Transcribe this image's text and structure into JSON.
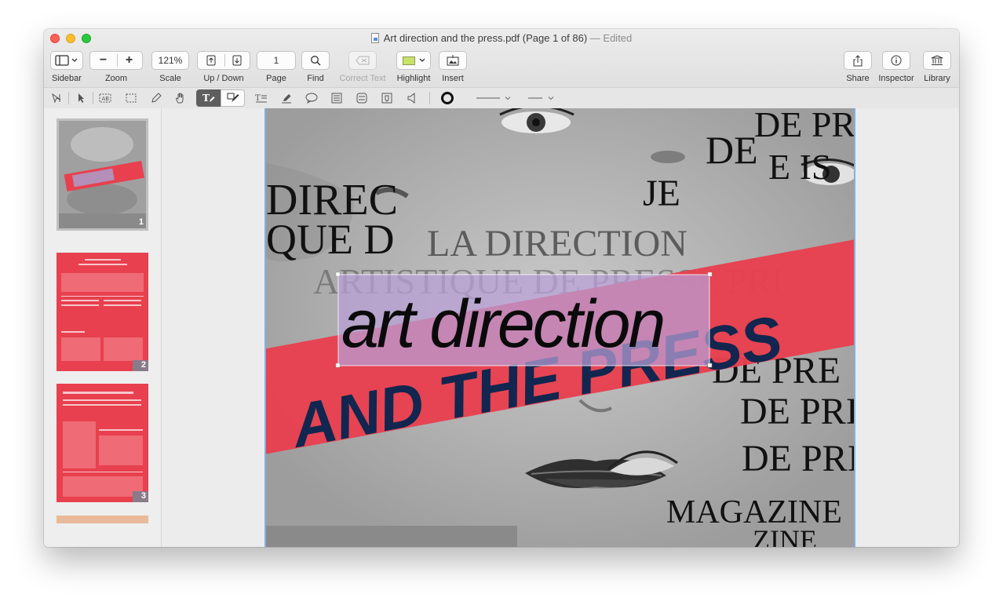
{
  "window": {
    "filename": "Art direction and the press.pdf",
    "page_info": "(Page 1 of 86)",
    "status": "— Edited"
  },
  "toolbar": {
    "sidebar_label": "Sidebar",
    "zoom_label": "Zoom",
    "zoom_out": "−",
    "zoom_in": "+",
    "scale_value": "121%",
    "scale_label": "Scale",
    "updown_label": "Up / Down",
    "page_value": "1",
    "page_label": "Page",
    "find_label": "Find",
    "correct_text_label": "Correct Text",
    "highlight_label": "Highlight",
    "highlight_color": "#c8e26a",
    "insert_label": "Insert",
    "share_label": "Share",
    "inspector_label": "Inspector",
    "library_label": "Library"
  },
  "sidebar": {
    "thumbnails": [
      {
        "number": "1"
      },
      {
        "number": "2"
      },
      {
        "number": "3"
      }
    ],
    "thumb_size": 0.45
  },
  "document": {
    "headline_main": "art direction",
    "headline_sub": "AND THE PRESS",
    "background_words": [
      "DE PRESSE",
      "DE",
      "DIREC",
      "E IS",
      "JE",
      "QUE D",
      "LA DIRECTION",
      "ARTISTIQUE DE PRESSE PRI",
      "DE PRE",
      "DE PRI",
      "DE PRI",
      "MAGAZINE",
      "ZINE"
    ],
    "banner_color": "#e8404e",
    "sub_color": "#12264f"
  }
}
